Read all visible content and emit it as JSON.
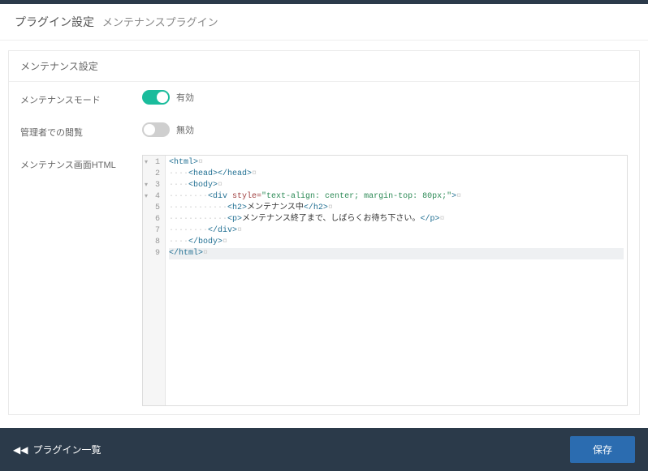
{
  "header": {
    "title": "プラグイン設定",
    "subtitle": "メンテナンスプラグイン"
  },
  "card": {
    "title": "メンテナンス設定"
  },
  "rows": {
    "mode": {
      "label": "メンテナンスモード",
      "state_label": "有効",
      "on": true
    },
    "admin_view": {
      "label": "管理者での閲覧",
      "state_label": "無効",
      "on": false
    },
    "html": {
      "label": "メンテナンス画面HTML"
    }
  },
  "code": {
    "lines": [
      {
        "n": 1,
        "fold": true,
        "active": false,
        "segments": [
          {
            "cls": "tok-tag",
            "t": "<html>"
          },
          {
            "cls": "tok-invis",
            "t": "¤"
          }
        ]
      },
      {
        "n": 2,
        "fold": false,
        "active": false,
        "segments": [
          {
            "cls": "tok-invis",
            "t": "····"
          },
          {
            "cls": "tok-tag",
            "t": "<head></head>"
          },
          {
            "cls": "tok-invis",
            "t": "¤"
          }
        ]
      },
      {
        "n": 3,
        "fold": true,
        "active": false,
        "segments": [
          {
            "cls": "tok-invis",
            "t": "····"
          },
          {
            "cls": "tok-tag",
            "t": "<body>"
          },
          {
            "cls": "tok-invis",
            "t": "¤"
          }
        ]
      },
      {
        "n": 4,
        "fold": true,
        "active": false,
        "segments": [
          {
            "cls": "tok-invis",
            "t": "········"
          },
          {
            "cls": "tok-tag",
            "t": "<div "
          },
          {
            "cls": "tok-attr",
            "t": "style="
          },
          {
            "cls": "tok-str",
            "t": "\"text-align: center; margin-top: 80px;\""
          },
          {
            "cls": "tok-tag",
            "t": ">"
          },
          {
            "cls": "tok-invis",
            "t": "¤"
          }
        ]
      },
      {
        "n": 5,
        "fold": false,
        "active": false,
        "segments": [
          {
            "cls": "tok-invis",
            "t": "············"
          },
          {
            "cls": "tok-tag",
            "t": "<h2>"
          },
          {
            "cls": "tok-text",
            "t": "メンテナンス中"
          },
          {
            "cls": "tok-tag",
            "t": "</h2>"
          },
          {
            "cls": "tok-invis",
            "t": "¤"
          }
        ]
      },
      {
        "n": 6,
        "fold": false,
        "active": false,
        "segments": [
          {
            "cls": "tok-invis",
            "t": "············"
          },
          {
            "cls": "tok-tag",
            "t": "<p>"
          },
          {
            "cls": "tok-text",
            "t": "メンテナンス終了まで、しばらくお待ち下さい。"
          },
          {
            "cls": "tok-tag",
            "t": "</p>"
          },
          {
            "cls": "tok-invis",
            "t": "¤"
          }
        ]
      },
      {
        "n": 7,
        "fold": false,
        "active": false,
        "segments": [
          {
            "cls": "tok-invis",
            "t": "········"
          },
          {
            "cls": "tok-tag",
            "t": "</div>"
          },
          {
            "cls": "tok-invis",
            "t": "¤"
          }
        ]
      },
      {
        "n": 8,
        "fold": false,
        "active": false,
        "segments": [
          {
            "cls": "tok-invis",
            "t": "····"
          },
          {
            "cls": "tok-tag",
            "t": "</body>"
          },
          {
            "cls": "tok-invis",
            "t": "¤"
          }
        ]
      },
      {
        "n": 9,
        "fold": false,
        "active": true,
        "segments": [
          {
            "cls": "tok-tag",
            "t": "</html>"
          },
          {
            "cls": "tok-invis",
            "t": "¤"
          }
        ]
      }
    ]
  },
  "footer": {
    "back_label": "プラグイン一覧",
    "save_label": "保存"
  }
}
